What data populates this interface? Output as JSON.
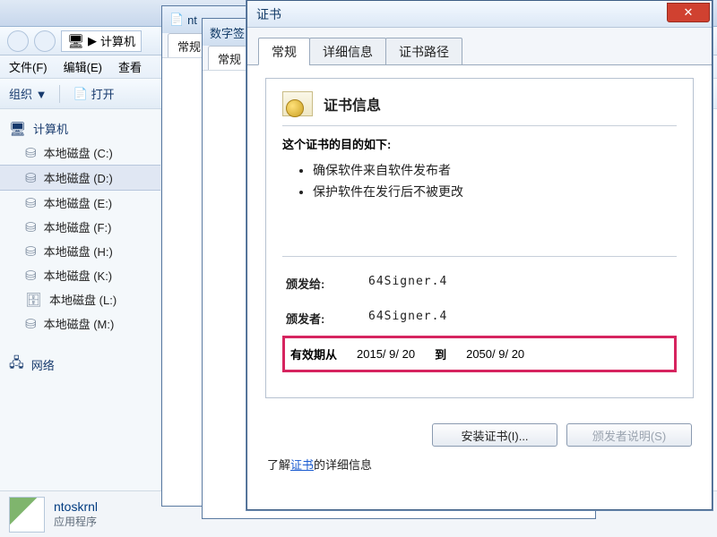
{
  "explorer": {
    "breadcrumb_label": "计算机",
    "breadcrumb_sep": "▶",
    "menus": {
      "file": "文件(F)",
      "edit": "编辑(E)",
      "view": "查看"
    },
    "toolbar": {
      "organize": "组织 ▼",
      "open": "打开"
    },
    "tree": {
      "computer": "计算机",
      "drives": [
        "本地磁盘 (C:)",
        "本地磁盘 (D:)",
        "本地磁盘 (E:)",
        "本地磁盘 (F:)",
        "本地磁盘 (H:)",
        "本地磁盘 (K:)",
        "本地磁盘 (L:)",
        "本地磁盘 (M:)"
      ],
      "selected_index": 1,
      "network": "网络"
    },
    "status": {
      "name": "ntoskrnl",
      "type": "应用程序"
    }
  },
  "stub1": {
    "title": "nt",
    "tab": "常规"
  },
  "stub2": {
    "title": "数字签",
    "tab": "常规"
  },
  "cert": {
    "window_title": "证书",
    "close_glyph": "✕",
    "tabs": {
      "general": "常规",
      "details": "详细信息",
      "path": "证书路径"
    },
    "info_heading": "证书信息",
    "purpose_title": "这个证书的目的如下:",
    "purposes": [
      "确保软件来自软件发布者",
      "保护软件在发行后不被更改"
    ],
    "issued_to_label": "颁发给:",
    "issued_to": "64Signer.4",
    "issued_by_label": "颁发者:",
    "issued_by": "64Signer.4",
    "valid_from_label": "有效期从",
    "valid_from": "2015/  9/ 20",
    "valid_to_label": "到",
    "valid_to": "2050/  9/ 20",
    "install_btn": "安装证书(I)...",
    "issuer_stmt_btn": "颁发者说明(S)",
    "learn_prefix": "了解",
    "learn_link": "证书",
    "learn_suffix": "的详细信息"
  }
}
